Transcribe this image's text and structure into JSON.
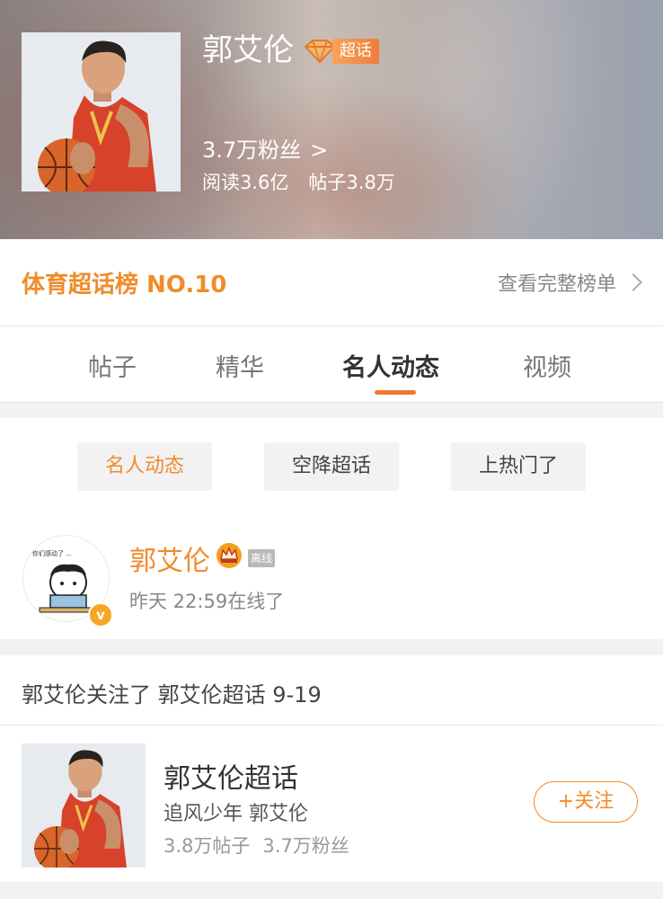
{
  "header": {
    "name": "郭艾伦",
    "super_tag": "超话",
    "fans": "3.7万粉丝",
    "fans_arrow": ">",
    "reads": "阅读3.6亿",
    "posts": "帖子3.8万"
  },
  "rank": {
    "title": "体育超话榜 NO.10",
    "link": "查看完整榜单"
  },
  "tabs": [
    {
      "label": "帖子"
    },
    {
      "label": "精华"
    },
    {
      "label": "名人动态",
      "active": true
    },
    {
      "label": "视频"
    }
  ],
  "filters": [
    {
      "label": "名人动态",
      "active": true
    },
    {
      "label": "空降超话"
    },
    {
      "label": "上热门了"
    }
  ],
  "user": {
    "name": "郭艾伦",
    "offline": "离线",
    "online_time": "昨天 22:59在线了",
    "verified": "v"
  },
  "activity": {
    "text": "郭艾伦关注了 郭艾伦超话 9-19",
    "card": {
      "title": "郭艾伦超话",
      "subtitle": "追风少年 郭艾伦",
      "posts": "3.8万帖子",
      "fans": "3.7万粉丝",
      "follow_label": "+关注"
    }
  },
  "colors": {
    "accent": "#f08c2a",
    "tab_underline": "#f3772d",
    "badge_gradient": [
      "#f7a35c",
      "#ef7d3a"
    ]
  }
}
